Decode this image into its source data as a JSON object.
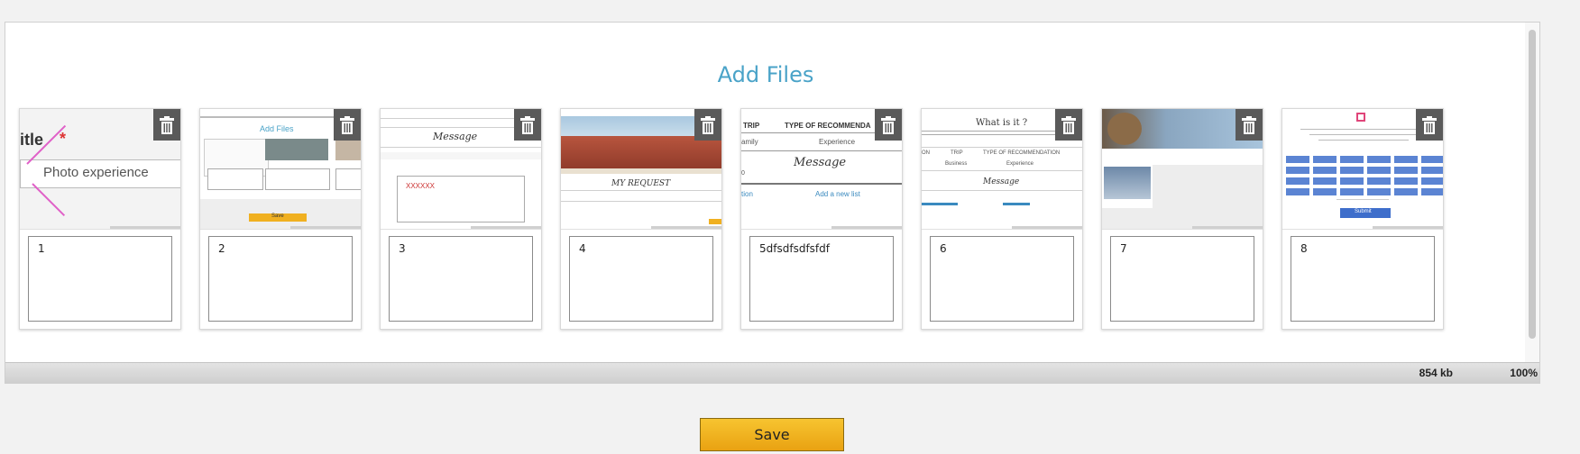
{
  "panel": {
    "title": "Add Files"
  },
  "cards": [
    {
      "caption": "1",
      "thumb": {
        "title_fragment": "itle",
        "required_mark": "*",
        "field_text": "Photo experience"
      }
    },
    {
      "caption": "2",
      "thumb": {
        "title": "Add Files",
        "button": "Save"
      }
    },
    {
      "caption": "3",
      "thumb": {
        "heading": "Message",
        "input_text": "XXXXXX"
      }
    },
    {
      "caption": "4",
      "thumb": {
        "heading": "MY REQUEST"
      }
    },
    {
      "caption": "5dfsdfsdfsfdf",
      "thumb": {
        "header_left": "TRIP",
        "header_right": "TYPE OF RECOMMENDA",
        "col1": "amily",
        "col2": "Experience",
        "heading": "Message",
        "row_left": "0",
        "row_link_left": "tion",
        "row_link_right": "Add a new list"
      }
    },
    {
      "caption": "6",
      "thumb": {
        "heading": "What is it ?",
        "col_a": "ON",
        "col_b": "TRIP",
        "col_c": "TYPE OF RECOMMENDATION",
        "sub_a": "Business",
        "sub_b": "Experience",
        "message": "Message"
      }
    },
    {
      "caption": "7",
      "thumb": {}
    },
    {
      "caption": "8",
      "thumb": {
        "submit": "Submit"
      }
    }
  ],
  "status": {
    "size": "854 kb",
    "zoom": "100%"
  },
  "save_label": "Save",
  "colors": {
    "title": "#4aa3c8",
    "save_button": "#f0b020",
    "delete_button": "#5a5a5a"
  }
}
